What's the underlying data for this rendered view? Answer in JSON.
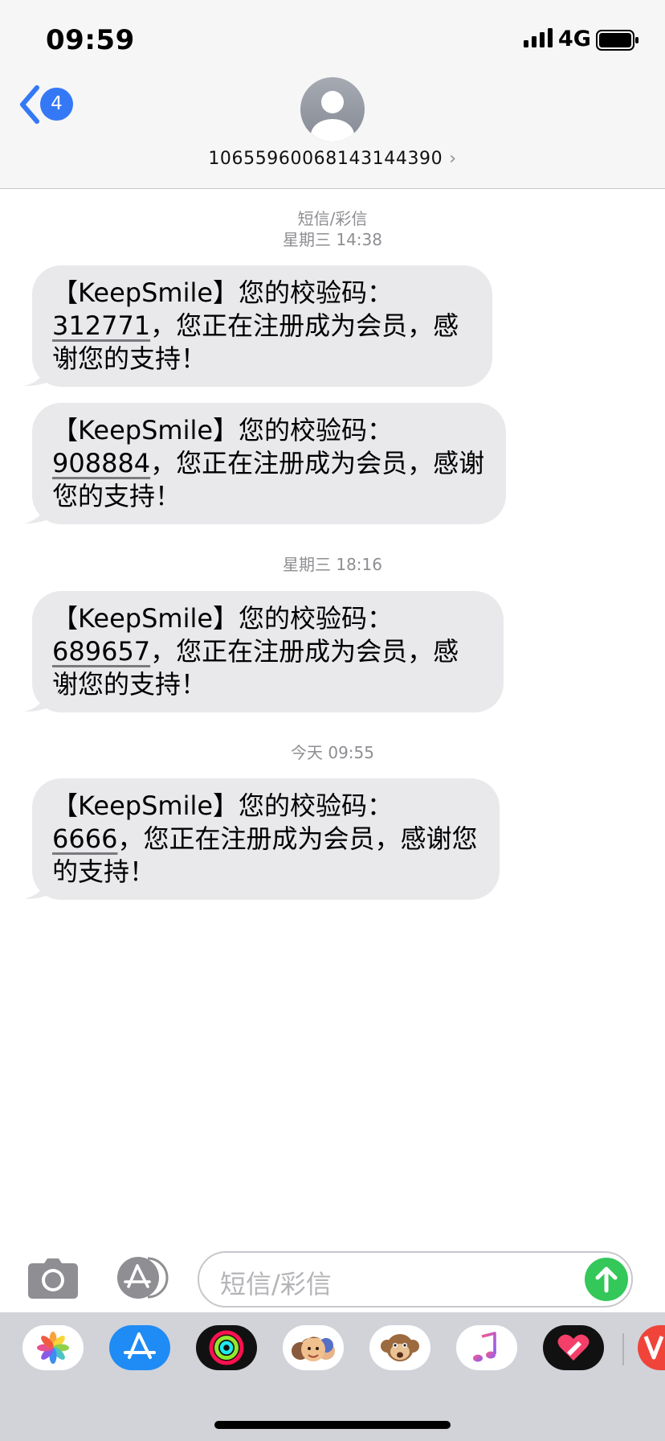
{
  "status_bar": {
    "time": "09:59",
    "network": "4G"
  },
  "nav": {
    "back_count": "4",
    "contact_number": "10655960068143144390",
    "contact_chevron": "›"
  },
  "conversation": {
    "service_label": "短信/彩信",
    "timestamps": [
      "星期三 14:38",
      "星期三 18:16",
      "今天 09:55"
    ],
    "messages": [
      {
        "prefix": "【KeepSmile】您的校验码：",
        "code": "312771",
        "suffix": "，您正在注册成为会员，感谢您的支持！"
      },
      {
        "prefix": "【KeepSmile】您的校验码：",
        "code": "908884",
        "suffix": "，您正在注册成为会员，感谢您的支持！"
      },
      {
        "prefix": "【KeepSmile】您的校验码：",
        "code": "689657",
        "suffix": "，您正在注册成为会员，感谢您的支持！"
      },
      {
        "prefix": "【KeepSmile】您的校验码：",
        "code": "6666",
        "suffix": "，您正在注册成为会员，感谢您的支持！"
      }
    ]
  },
  "input_bar": {
    "placeholder": "短信/彩信"
  },
  "app_drawer": {
    "apps": [
      "photos-app-icon",
      "app-store-app-icon",
      "activity-app-icon",
      "memoji-app-icon",
      "animoji-app-icon",
      "music-app-icon",
      "heart-app-icon",
      "partial-app-icon"
    ]
  },
  "colors": {
    "accent": "#3478f6",
    "bubble": "#e9e9eb",
    "send": "#34c759",
    "meta": "#8e8e93"
  }
}
